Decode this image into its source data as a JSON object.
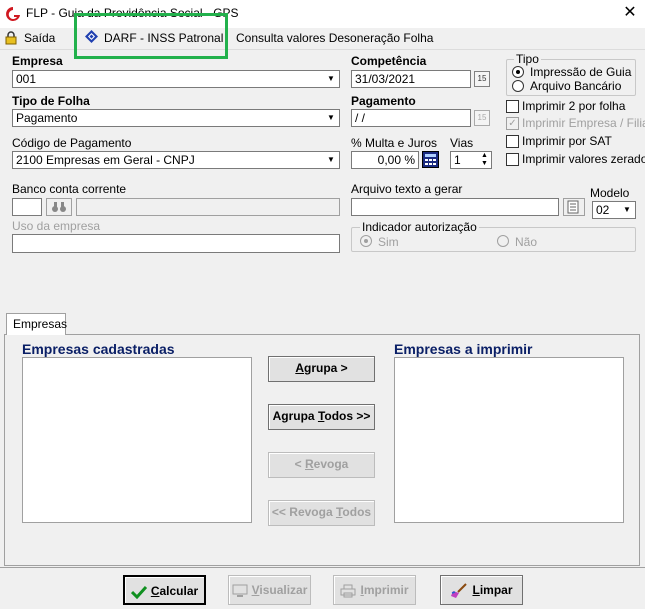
{
  "window": {
    "title": "FLP - Guia da Previdência Social - GPS"
  },
  "menu": {
    "saida": "Saída",
    "darf": "DARF - INSS Patronal",
    "consulta": "Consulta valores Desoneração Folha"
  },
  "form": {
    "empresa": {
      "label": "Empresa",
      "value": "001"
    },
    "competencia": {
      "label": "Competência",
      "value": "31/03/2021"
    },
    "tipo_folha": {
      "label": "Tipo de Folha",
      "value": "Pagamento"
    },
    "pagamento": {
      "label": "Pagamento",
      "value": " /  /"
    },
    "codigo_pagamento": {
      "label": "Código de Pagamento",
      "value": "2100  Empresas em Geral - CNPJ"
    },
    "multa_juros": {
      "label": "% Multa e Juros",
      "value": "0,00 %"
    },
    "vias": {
      "label": "Vias",
      "value": "1"
    },
    "banco": {
      "label": "Banco conta corrente"
    },
    "uso_empresa": {
      "label": "Uso da empresa"
    },
    "arquivo_texto": {
      "label": "Arquivo texto a gerar"
    },
    "modelo": {
      "label": "Modelo",
      "value": "02"
    }
  },
  "tipo": {
    "title": "Tipo",
    "options": [
      "Impressão de Guia",
      "Arquivo Bancário"
    ]
  },
  "checks": {
    "imprimir2": "Imprimir 2 por folha",
    "imprimir_empresa": "Imprimir Empresa / Filial",
    "imprimir_sat": "Imprimir por SAT",
    "imprimir_zerados": "Imprimir valores zerados"
  },
  "indicador": {
    "title": "Indicador autorização",
    "sim": "Sim",
    "nao": "Não"
  },
  "tab": {
    "empresas": "Empresas"
  },
  "panel": {
    "cadastradas": "Empresas cadastradas",
    "imprimir": "Empresas a imprimir",
    "agrupa_pre": "",
    "agrupa_u": "A",
    "agrupa_post": "grupa >",
    "agrupa_todos_pre": "Agrupa ",
    "agrupa_todos_u": "T",
    "agrupa_todos_post": "odos >>",
    "revoga_pre": "< ",
    "revoga_u": "R",
    "revoga_post": "evoga",
    "revoga_todos_pre": "<< Revoga ",
    "revoga_todos_u": "T",
    "revoga_todos_post": "odos"
  },
  "footer": {
    "calcular_u": "C",
    "calcular_post": "alcular",
    "visualizar_u": "V",
    "visualizar_post": "isualizar",
    "imprimir_u": "I",
    "imprimir_post": "mprimir",
    "limpar_u": "L",
    "limpar_post": "impar"
  },
  "colors": {
    "highlight": "#22b14c",
    "panel_title": "#0a1f66"
  }
}
